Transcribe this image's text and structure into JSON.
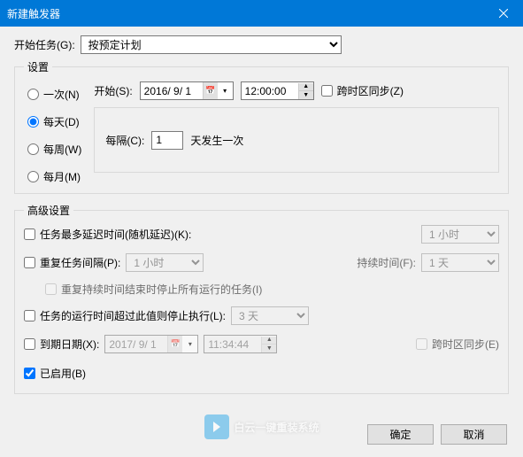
{
  "window": {
    "title": "新建触发器"
  },
  "task_label": "开始任务(G):",
  "task_value": "按预定计划",
  "settings_legend": "设置",
  "freq": {
    "once": "一次(N)",
    "daily": "每天(D)",
    "weekly": "每周(W)",
    "monthly": "每月(M)"
  },
  "start": {
    "label": "开始(S):",
    "date": "2016/ 9/ 1",
    "time": "12:00:00",
    "tz_sync": "跨时区同步(Z)"
  },
  "recur": {
    "label": "每隔(C):",
    "value": "1",
    "suffix": "天发生一次"
  },
  "adv_legend": "高级设置",
  "adv": {
    "delay": {
      "label": "任务最多延迟时间(随机延迟)(K):",
      "value": "1 小时"
    },
    "repeat": {
      "label": "重复任务间隔(P):",
      "value": "1 小时",
      "dur_label": "持续时间(F):",
      "dur_value": "1 天"
    },
    "stop_repeat": "重复持续时间结束时停止所有运行的任务(I)",
    "stop_after": {
      "label": "任务的运行时间超过此值则停止执行(L):",
      "value": "3 天"
    },
    "expire": {
      "label": "到期日期(X):",
      "date": "2017/ 9/ 1",
      "time": "11:34:44",
      "tz": "跨时区同步(E)"
    },
    "enabled": "已启用(B)"
  },
  "buttons": {
    "ok": "确定",
    "cancel": "取消"
  },
  "watermark": "白云一键重装系统"
}
